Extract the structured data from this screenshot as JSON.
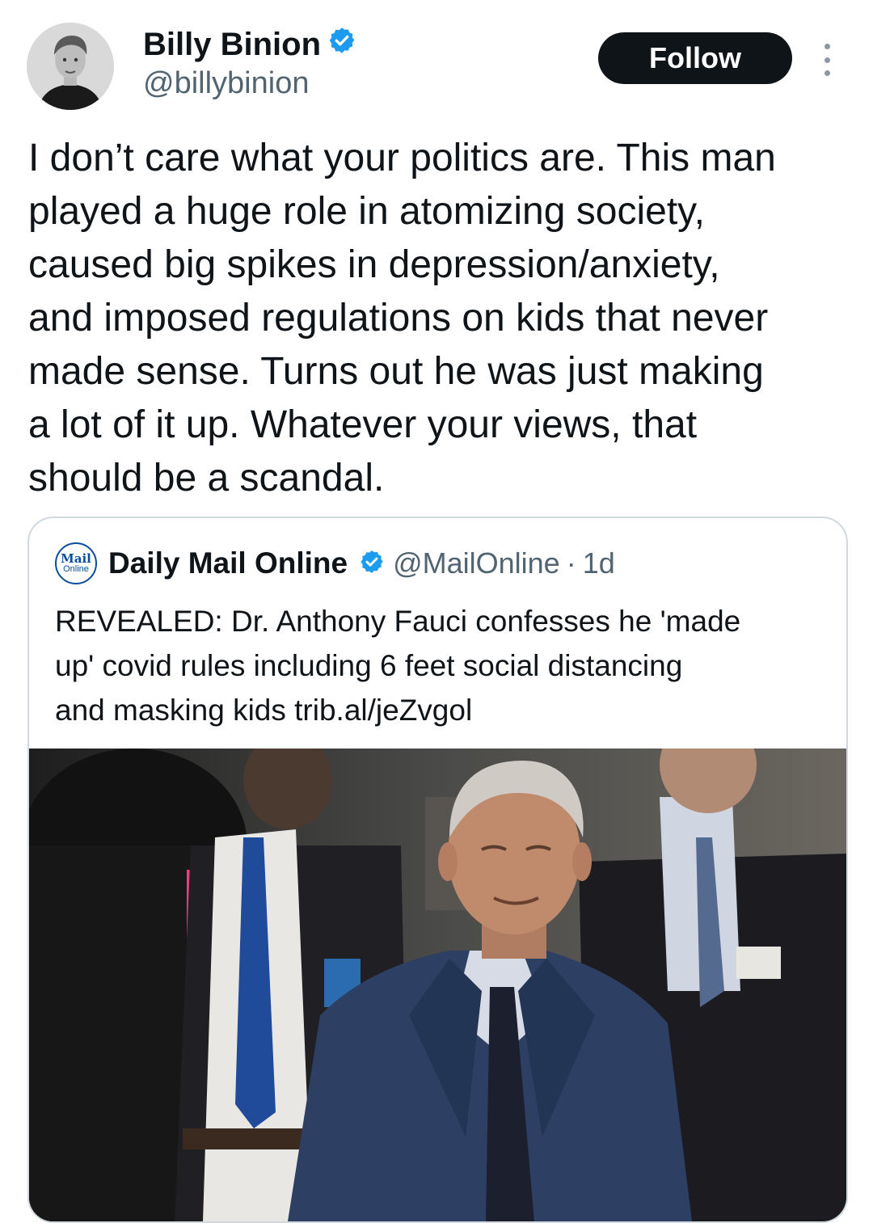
{
  "author": {
    "name": "Billy Binion",
    "handle": "@billybinion",
    "verified_color": "#1d9bf0"
  },
  "actions": {
    "follow_label": "Follow",
    "more_icon": "more-vertical-icon"
  },
  "tweet": {
    "lines": [
      "I don’t care what your politics are. This man",
      "played a huge role in atomizing society,",
      "caused big spikes in depression/anxiety,",
      "and imposed regulations on kids that never",
      "made sense. Turns out he was just making",
      "a lot of it up. Whatever your views, that",
      "should be a scandal."
    ]
  },
  "quote": {
    "logo_line1": "Mail",
    "logo_line2": "Online",
    "name": "Daily Mail Online",
    "handle": "@MailOnline",
    "separator": "·",
    "time": "1d",
    "lines": [
      "REVEALED: Dr. Anthony Fauci confesses he 'made",
      "up' covid rules including 6 feet social distancing",
      "and masking kids trib.al/jeZvgol"
    ]
  },
  "colors": {
    "text": "#0f1419",
    "muted": "#536471",
    "border": "#cfd9de",
    "verified": "#1d9bf0"
  }
}
